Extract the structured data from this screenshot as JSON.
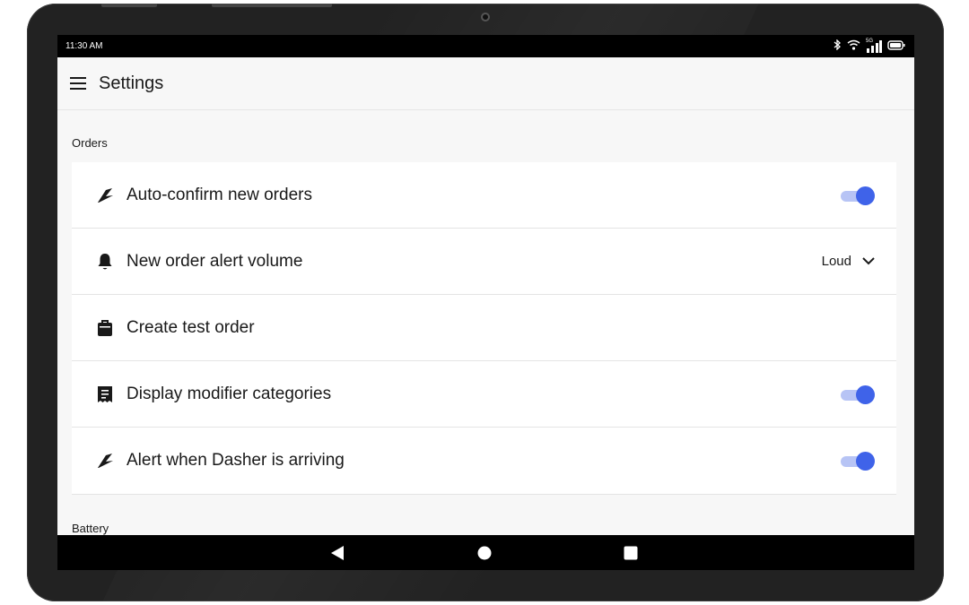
{
  "status_bar": {
    "time": "11:30 AM",
    "icons": [
      "bluetooth-icon",
      "wifi-icon",
      "cellular-signal-icon",
      "battery-icon"
    ],
    "network_label": "5G"
  },
  "app_bar": {
    "title": "Settings",
    "menu_icon": "hamburger-menu-icon"
  },
  "sections": {
    "orders": {
      "header": "Orders",
      "items": [
        {
          "icon": "lightning-icon",
          "label": "Auto-confirm new orders",
          "control": "toggle",
          "on": true
        },
        {
          "icon": "bell-icon",
          "label": "New order alert volume",
          "control": "select",
          "value": "Loud"
        },
        {
          "icon": "bag-icon",
          "label": "Create test order",
          "control": "none"
        },
        {
          "icon": "receipt-icon",
          "label": "Display modifier categories",
          "control": "toggle",
          "on": true
        },
        {
          "icon": "lightning-icon",
          "label": "Alert when Dasher is arriving",
          "control": "toggle",
          "on": true
        }
      ]
    },
    "battery": {
      "header": "Battery"
    }
  },
  "nav_bar": {
    "buttons": [
      "back-icon",
      "home-icon",
      "recents-icon"
    ]
  },
  "colors": {
    "accent": "#3f63e9",
    "toggle_track": "#b7c4f5",
    "background": "#f7f7f7",
    "text": "#191919"
  }
}
